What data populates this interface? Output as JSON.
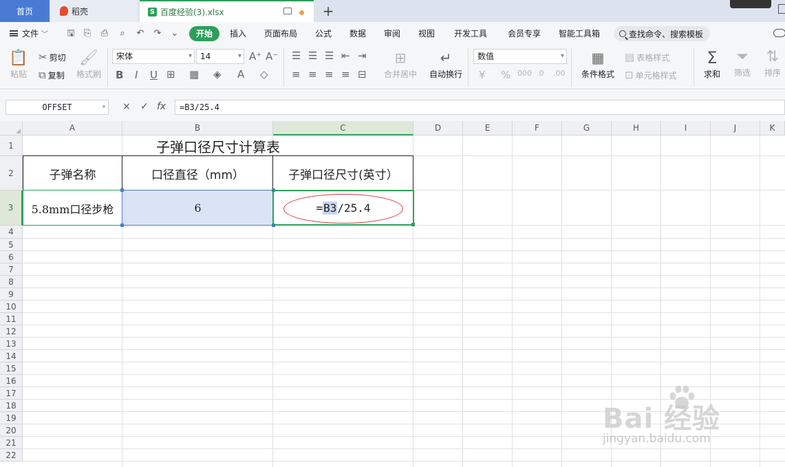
{
  "tabs": {
    "home": "首页",
    "daoke": "稻壳",
    "file": "百度经验(3).xlsx",
    "add": "+"
  },
  "menu": {
    "file": "文件",
    "start": "开始",
    "insert": "插入",
    "page_layout": "页面布局",
    "formula": "公式",
    "data": "数据",
    "review": "审阅",
    "view": "视图",
    "dev_tools": "开发工具",
    "member": "会员专享",
    "smart_tools": "智能工具箱",
    "search": "查找命令、搜索模板"
  },
  "ribbon": {
    "paste": "粘贴",
    "cut": "剪切",
    "copy": "复制",
    "format_painter": "格式刷",
    "font_name": "宋体",
    "font_size": "14",
    "merge_center": "合并居中",
    "wrap_text": "自动换行",
    "number_format": "数值",
    "conditional_format": "条件格式",
    "table_style": "表格样式",
    "cell_style": "单元格样式",
    "sum": "求和",
    "filter": "筛选",
    "sort": "排序"
  },
  "formula_bar": {
    "name_box": "OFFSET",
    "cancel": "×",
    "confirm": "✓",
    "fx": "fx",
    "formula": "=B3/25.4"
  },
  "sheet": {
    "columns": [
      "A",
      "B",
      "C",
      "D",
      "E",
      "F",
      "G",
      "H",
      "I",
      "J",
      "K"
    ],
    "rows": [
      "1",
      "2",
      "3",
      "4",
      "5",
      "6",
      "7",
      "8",
      "9",
      "10",
      "11",
      "12",
      "13",
      "14",
      "15",
      "16",
      "17",
      "18",
      "19",
      "20",
      "21",
      "22"
    ],
    "title": "子弹口径尺寸计算表",
    "headers": [
      "子弹名称",
      "口径直径（mm）",
      "子弹口径尺寸(英寸）"
    ],
    "row3": {
      "a": "5.8mm口径步枪",
      "b": "6",
      "c_prefix": "=",
      "c_ref": "B3",
      "c_suffix": "/25.4"
    }
  },
  "watermark": {
    "logo": "Bai  经验",
    "url": "jingyan.baidu.com"
  },
  "colors": {
    "accent_green": "#2ba05a",
    "selection_blue": "#4a7bd4",
    "annotation_red": "#d9383a"
  }
}
